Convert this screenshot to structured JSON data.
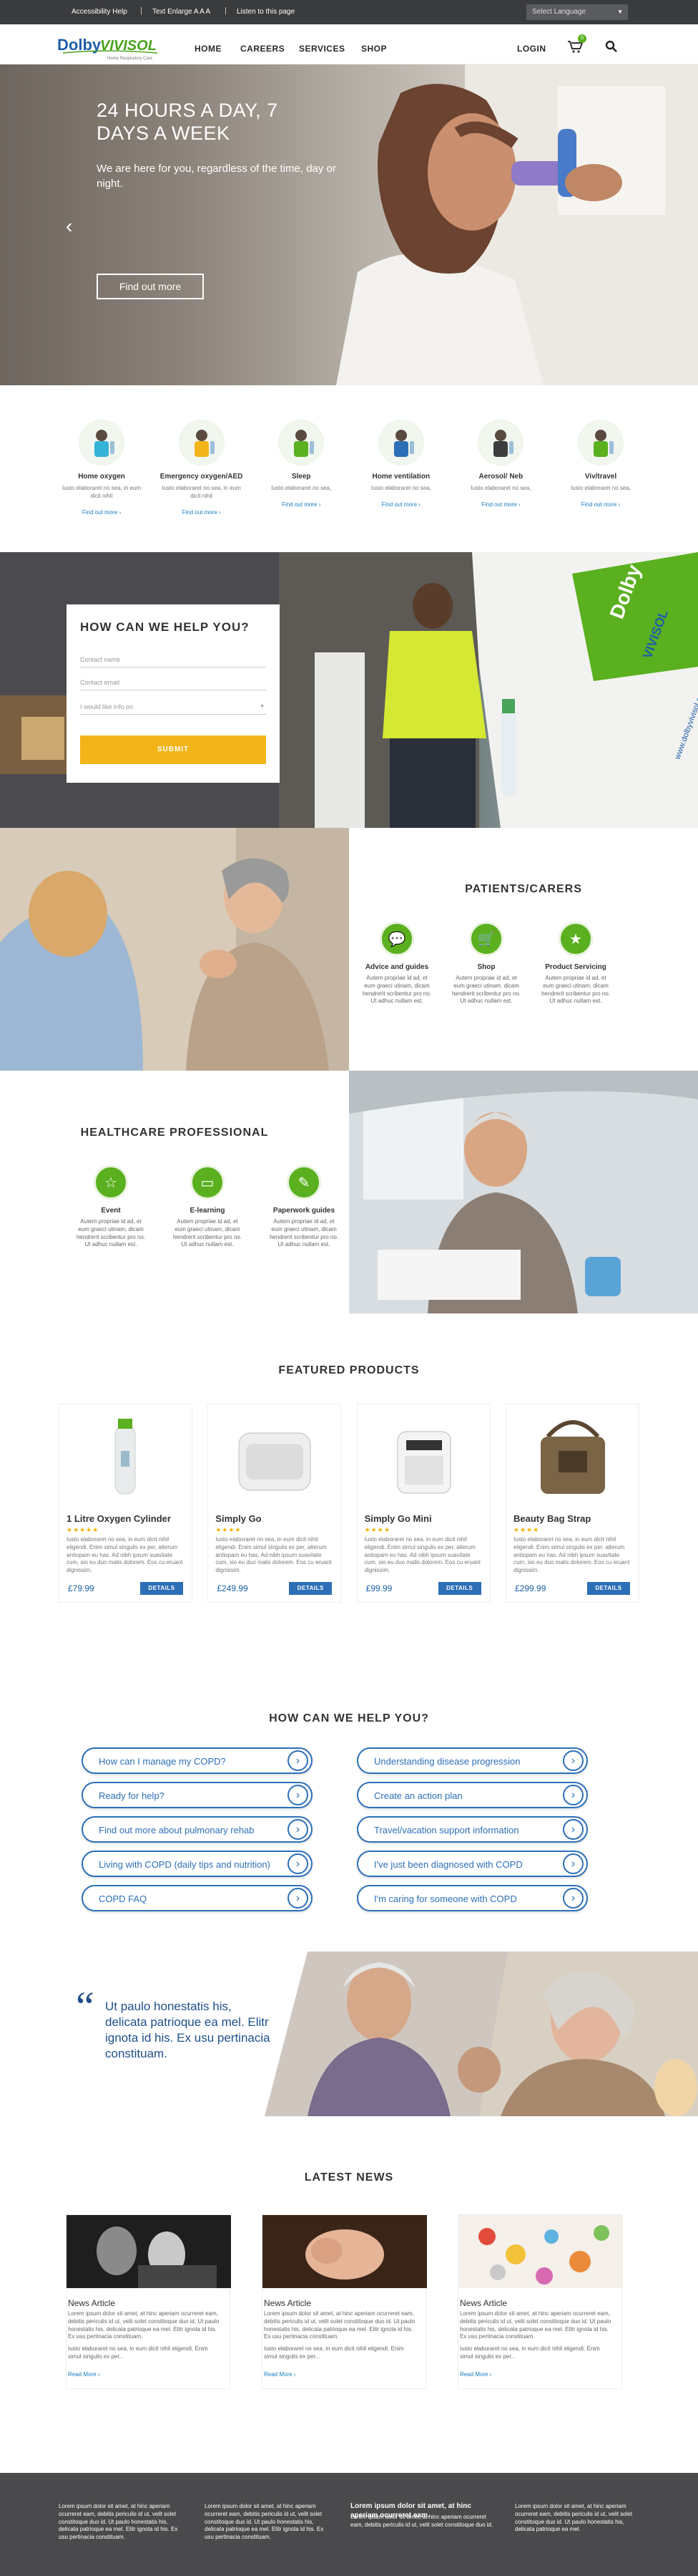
{
  "topbar": {
    "accessibility": "Accessibility Help",
    "enlarge": "Text Enlarge A A A",
    "listen": "Listen to this page",
    "language": "Select Language"
  },
  "logo": {
    "brand": "DolbyVIVISOL",
    "tagline": "Home Respiratory Care"
  },
  "nav": {
    "home": "HOME",
    "careers": "CAREERS",
    "services": "SERVICES",
    "shop": "SHOP",
    "login": "LOGIN",
    "cart_count": "0"
  },
  "hero": {
    "title": "24 HOURS A DAY, 7 DAYS A WEEK",
    "subtitle": "We are here for you, regardless of the time, day or night.",
    "button": "Find out more"
  },
  "services": [
    {
      "title": "Home oxygen",
      "text": "Iusto elaboraret no sea, in eum dicit nihil",
      "link": "Find out more ›",
      "color": "#34b3d6"
    },
    {
      "title": "Emergency oxygen/AED",
      "text": "Iusto elaboraret no sea, in eum dicit nihil",
      "link": "Find out more ›",
      "color": "#f2b418"
    },
    {
      "title": "Sleep",
      "text": "Iusto elaboraret no sea,",
      "link": "Find out more ›",
      "color": "#5ab01f"
    },
    {
      "title": "Home ventilation",
      "text": "Iusto elaboraret no sea,",
      "link": "Find out more ›",
      "color": "#2d6fb7"
    },
    {
      "title": "Aerosol/ Neb",
      "text": "Iusto elaboraret no sea,",
      "link": "Find out more ›",
      "color": "#3d3d3d"
    },
    {
      "title": "Viv/travel",
      "text": "Iusto elaboraret no sea,",
      "link": "Find out more ›",
      "color": "#5ab01f"
    }
  ],
  "help_form": {
    "title": "HOW CAN WE HELP YOU?",
    "name_placeholder": "Contact name",
    "email_placeholder": "Contact email",
    "select": "I would like info on",
    "submit": "SUBMIT",
    "van_text": "www.dolbyvivisol.com"
  },
  "patients": {
    "title": "PATIENTS/CARERS",
    "items": [
      {
        "title": "Advice and guides",
        "text": "Autem propriae id ad, et eum graeci utinam, dicam hendrerit scribentur pro no. Ut adhuc nullam est."
      },
      {
        "title": "Shop",
        "text": "Autem propriae id ad, et eum graeci utinam, dicam hendrerit scribentur pro no. Ut adhuc nullam est."
      },
      {
        "title": "Product Servicing",
        "text": "Autem propriae id ad, et eum graeci utinam, dicam hendrerit scribentur pro no. Ut adhuc nullam est."
      }
    ]
  },
  "healthcare": {
    "title": "HEALTHCARE PROFESSIONAL",
    "items": [
      {
        "title": "Event",
        "text": "Autem propriae id ad, et eum graeci utinam, dicam hendrerit scribentur pro no. Ut adhuc nullam est."
      },
      {
        "title": "E-learning",
        "text": "Autem propriae id ad, et eum graeci utinam, dicam hendrerit scribentur pro no. Ut adhuc nullam est."
      },
      {
        "title": "Paperwork guides",
        "text": "Autem propriae id ad, et eum graeci utinam, dicam hendrerit scribentur pro no. Ut adhuc nullam est."
      }
    ]
  },
  "products": {
    "title": "FEATURED PRODUCTS",
    "items": [
      {
        "name": "1 Litre Oxygen Cylinder",
        "stars": "★★★★★",
        "desc": "Iusto elaboraret no sea, in eum dicit nihil eligendi. Enim simul singulis ex per, alterum antiopam eu has. Ad nibh ipsum suavitate cum, sio eu duo malis dolorem. Eos cu eruant dignissim.",
        "price": "£79.99",
        "button": "DETAILS"
      },
      {
        "name": "Simply Go",
        "stars": "★★★★",
        "desc": "Iusto elaboraret no sea, in eum dicit nihil eligendi. Enim simul singulis ex per, alterum antiopam eu has. Ad nibh ipsum suavitate cum, sio eu duo malis dolorem. Eos cu eruant dignissim.",
        "price": "£249.99",
        "button": "DETAILS"
      },
      {
        "name": "Simply Go Mini",
        "stars": "★★★★",
        "desc": "Iusto elaboraret no sea, in eum dicit nihil eligendi. Enim simul singulis ex per, alterum antiopam eu has. Ad nibh ipsum suavitate cum, sio eu duo malis dolorem. Eos cu eruant dignissim.",
        "price": "£99.99",
        "button": "DETAILS"
      },
      {
        "name": "Beauty Bag Strap",
        "stars": "★★★★",
        "desc": "Iusto elaboraret no sea, in eum dicit nihil eligendi. Enim simul singulis ex per, alterum antiopam eu has. Ad nibh ipsum suavitate cum, sio eu duo malis dolorem. Eos cu eruant dignissim.",
        "price": "£299.99",
        "button": "DETAILS"
      }
    ]
  },
  "faq": {
    "title": "HOW CAN WE HELP YOU?",
    "left": [
      "How can I manage my COPD?",
      "Ready for help?",
      "Find out more about pulmonary rehab",
      "Living with COPD (daily tips and nutrition)",
      "COPD FAQ"
    ],
    "right": [
      "Understanding disease progression",
      "Create an action plan",
      "Travel/vacation support information",
      "I've just been diagnosed with COPD",
      "I'm caring for someone with COPD"
    ]
  },
  "quote": {
    "mark": "“",
    "text": "Ut paulo honestatis his, delicata patrioque ea mel. Elitr ignota id his. Ex usu pertinacia constituam."
  },
  "news": {
    "title": "LATEST NEWS",
    "items": [
      {
        "title": "News Article",
        "text1": "Lorem ipsum dolor sit amet, at hinc aperiam ocurreret eam, debitis periculis id ut, velit solet constitoque duo id. Ut paulo honestatis his, delicata patrioque ea mel. Elitr ignota id his. Ex usu pertinacia constituam.",
        "text2": "Iusto elaboraret no sea, in eum dicit nihil eligendi. Enim simul singulis ex per...",
        "more": "Read More ›"
      },
      {
        "title": "News Article",
        "text1": "Lorem ipsum dolor sit amet, at hinc aperiam ocurreret eam, debitis periculis id ut, velit solet constitoque duo id. Ut paulo honestatis his, delicata patrioque ea mel. Elitr ignota id his. Ex usu pertinacia constituam.",
        "text2": "Iusto elaboraret no sea, in eum dicit nihil eligendi. Enim simul singulis ex per...",
        "more": "Read More ›"
      },
      {
        "title": "News Article",
        "text1": "Lorem ipsum dolor sit amet, at hinc aperiam ocurreret eam, debitis periculis id ut, velit solet constitoque duo id. Ut paulo honestatis his, delicata patrioque ea mel. Elitr ignota id his. Ex usu pertinacia constituam.",
        "text2": "Iusto elaboraret no sea, in eum dicit nihil eligendi. Enim simul singulis ex per...",
        "more": "Read More ›"
      }
    ]
  },
  "footer": {
    "col1": "Lorem ipsum dolor sit amet, at hinc aperiam ocurreret eam, debitis periculis id ut, velit solet constitoque duo id. Ut paulo honestatis his, delicata patrioque ea mel. Elitr ignota id his. Ex usu pertinacia constituam.",
    "col2": "Lorem ipsum dolor sit amet, at hinc aperiam ocurreret eam, debitis periculis id ut, velit solet constitoque duo id. Ut paulo honestatis his, delicata patrioque ea mel. Elitr ignota id his. Ex usu pertinacia constituam.",
    "col3_title": "Lorem ipsum dolor sit amet, at hinc aperiam ocurreret eam.",
    "col3": "Lorem ipsum dolor sit amet, at hinc aperiam ocurreret eam, debitis periculis id ut, velit solet constitoque duo id.",
    "col4": "Lorem ipsum dolor sit amet, at hinc aperiam ocurreret eam, debitis periculis id ut, velit solet constitoque duo id. Ut paulo honestatis his, delicata patrioque ea mel."
  },
  "colors": {
    "brand_blue": "#2d6fb7",
    "brand_green": "#5ab01f",
    "accent_yellow": "#f2b418",
    "dark": "#3a3b3d"
  }
}
